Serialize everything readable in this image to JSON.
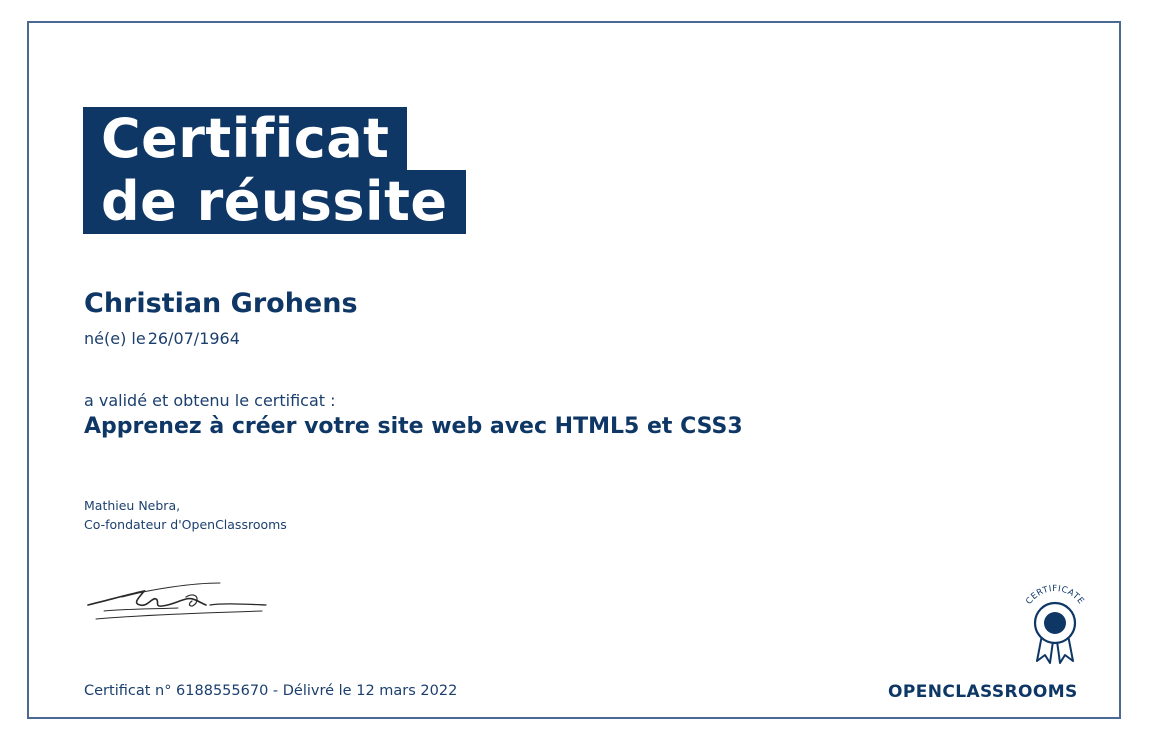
{
  "certificate": {
    "title_line1": "Certificat",
    "title_line2": "de réussite",
    "recipient_name": "Christian Grohens",
    "birth_label": "né(e) le",
    "birth_date": "26/07/1964",
    "validated_text": "a validé et obtenu le certificat :",
    "course_title": "Apprenez à créer votre site web avec HTML5 et CSS3",
    "signer_name": "Mathieu Nebra,",
    "signer_role": "Co-fondateur d'OpenClassrooms",
    "certificate_number_line": "Certificat n° 6188555670 - Délivré le 12 mars 2022",
    "badge_text": "CERTIFICATE",
    "logo_text": "OPENCLASSROOMS"
  },
  "colors": {
    "brand_navy": "#0e3766",
    "text_blue": "#1b3f6e",
    "frame_border": "#4a6a93",
    "background": "#ffffff"
  },
  "icons": {
    "badge": "certificate-rosette-icon",
    "signature": "handwritten-signature"
  }
}
